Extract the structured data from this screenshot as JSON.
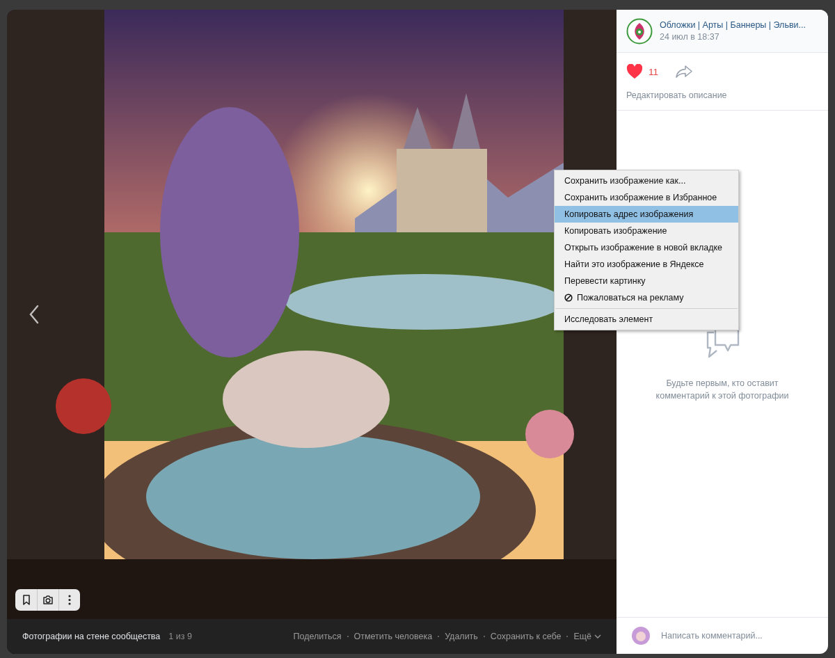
{
  "author": {
    "name": "Обложки | Арты | Баннеры | Эльви...",
    "date": "24 июл в 18:37"
  },
  "likes": {
    "count": "11",
    "liked": true
  },
  "edit_description": "Редактировать описание",
  "empty_comments": "Будьте первым, кто оставит комментарий к этой фотографии",
  "comment_field": {
    "placeholder": "Написать комментарий..."
  },
  "footer": {
    "album": "Фотографии на стене сообщества",
    "counter": "1 из 9",
    "actions": [
      "Поделиться",
      "Отметить человека",
      "Удалить",
      "Сохранить к себе"
    ],
    "more": "Ещё"
  },
  "context_menu": {
    "groups": [
      [
        {
          "label": "Сохранить изображение как...",
          "kind": "plain",
          "selected": false
        },
        {
          "label": "Сохранить изображение в Избранное",
          "kind": "plain",
          "selected": false
        },
        {
          "label": "Копировать адрес изображения",
          "kind": "plain",
          "selected": true
        },
        {
          "label": "Копировать изображение",
          "kind": "plain",
          "selected": false
        },
        {
          "label": "Открыть изображение в новой вкладке",
          "kind": "plain",
          "selected": false
        },
        {
          "label": "Найти это изображение в Яндексе",
          "kind": "plain",
          "selected": false
        },
        {
          "label": "Перевести картинку",
          "kind": "plain",
          "selected": false
        },
        {
          "label": "Пожаловаться на рекламу",
          "kind": "blocked",
          "selected": false
        }
      ],
      [
        {
          "label": "Исследовать элемент",
          "kind": "plain",
          "selected": false
        }
      ]
    ]
  }
}
